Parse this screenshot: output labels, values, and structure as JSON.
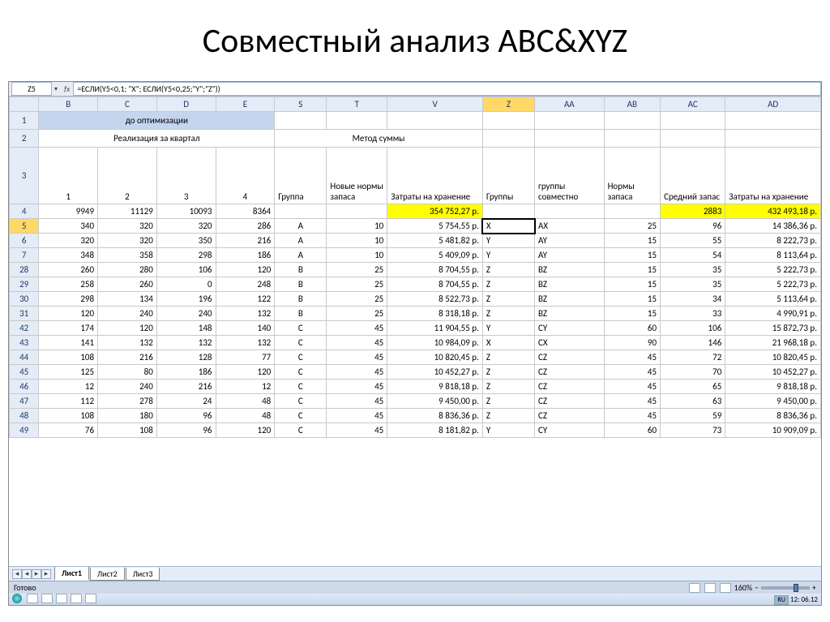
{
  "slide": {
    "title": "Совместный анализ ABC&XYZ"
  },
  "formula_bar": {
    "cell_ref": "Z5",
    "fx": "fx",
    "formula": "=ЕСЛИ(Y5<0,1; \"X\"; ЕСЛИ(Y5<0,25;\"Y\";\"Z\"))"
  },
  "columns": [
    "B",
    "C",
    "D",
    "E",
    "S",
    "T",
    "V",
    "Z",
    "AA",
    "AB",
    "AC",
    "AD"
  ],
  "headers": {
    "r1_merge": "до оптимизации",
    "r2_left": "Реализация за квартал",
    "r2_right": "Метод суммы",
    "q1": "1",
    "q2": "2",
    "q3": "3",
    "q4": "4",
    "group": "Группа",
    "newnorm": "Новые нормы запаса",
    "cost": "Затраты на хранение",
    "groups": "Группы",
    "combined": "группы совместно",
    "norm": "Нормы запаса",
    "avg": "Средний запас",
    "cost2": "Затраты на хранение"
  },
  "rows": [
    {
      "n": "4",
      "c": [
        "9949",
        "11129",
        "10093",
        "8364",
        "",
        "",
        "354 752,27 р.",
        "",
        "",
        "",
        "2883",
        "432 493,18 р."
      ],
      "yellow": [
        6,
        10,
        11
      ]
    },
    {
      "n": "5",
      "c": [
        "340",
        "320",
        "320",
        "286",
        "A",
        "10",
        "5 754,55 р.",
        "X",
        "AX",
        "25",
        "96",
        "14 386,36 р."
      ],
      "sel": 7
    },
    {
      "n": "6",
      "c": [
        "320",
        "320",
        "350",
        "216",
        "A",
        "10",
        "5 481,82 р.",
        "Y",
        "AY",
        "15",
        "55",
        "8 222,73 р."
      ]
    },
    {
      "n": "7",
      "c": [
        "348",
        "358",
        "298",
        "186",
        "A",
        "10",
        "5 409,09 р.",
        "Y",
        "AY",
        "15",
        "54",
        "8 113,64 р."
      ]
    },
    {
      "n": "28",
      "c": [
        "260",
        "280",
        "106",
        "120",
        "B",
        "25",
        "8 704,55 р.",
        "Z",
        "BZ",
        "15",
        "35",
        "5 222,73 р."
      ]
    },
    {
      "n": "29",
      "c": [
        "258",
        "260",
        "0",
        "248",
        "B",
        "25",
        "8 704,55 р.",
        "Z",
        "BZ",
        "15",
        "35",
        "5 222,73 р."
      ]
    },
    {
      "n": "30",
      "c": [
        "298",
        "134",
        "196",
        "122",
        "B",
        "25",
        "8 522,73 р.",
        "Z",
        "BZ",
        "15",
        "34",
        "5 113,64 р."
      ]
    },
    {
      "n": "31",
      "c": [
        "120",
        "240",
        "240",
        "132",
        "B",
        "25",
        "8 318,18 р.",
        "Z",
        "BZ",
        "15",
        "33",
        "4 990,91 р."
      ]
    },
    {
      "n": "42",
      "c": [
        "174",
        "120",
        "148",
        "140",
        "C",
        "45",
        "11 904,55 р.",
        "Y",
        "CY",
        "60",
        "106",
        "15 872,73 р."
      ]
    },
    {
      "n": "43",
      "c": [
        "141",
        "132",
        "132",
        "132",
        "C",
        "45",
        "10 984,09 р.",
        "X",
        "CX",
        "90",
        "146",
        "21 968,18 р."
      ]
    },
    {
      "n": "44",
      "c": [
        "108",
        "216",
        "128",
        "77",
        "C",
        "45",
        "10 820,45 р.",
        "Z",
        "CZ",
        "45",
        "72",
        "10 820,45 р."
      ]
    },
    {
      "n": "45",
      "c": [
        "125",
        "80",
        "186",
        "120",
        "C",
        "45",
        "10 452,27 р.",
        "Z",
        "CZ",
        "45",
        "70",
        "10 452,27 р."
      ]
    },
    {
      "n": "46",
      "c": [
        "12",
        "240",
        "216",
        "12",
        "C",
        "45",
        "9 818,18 р.",
        "Z",
        "CZ",
        "45",
        "65",
        "9 818,18 р."
      ]
    },
    {
      "n": "47",
      "c": [
        "112",
        "278",
        "24",
        "48",
        "C",
        "45",
        "9 450,00 р.",
        "Z",
        "CZ",
        "45",
        "63",
        "9 450,00 р."
      ]
    },
    {
      "n": "48",
      "c": [
        "108",
        "180",
        "96",
        "48",
        "C",
        "45",
        "8 836,36 р.",
        "Z",
        "CZ",
        "45",
        "59",
        "8 836,36 р."
      ]
    },
    {
      "n": "49",
      "c": [
        "76",
        "108",
        "96",
        "120",
        "C",
        "45",
        "8 181,82 р.",
        "Y",
        "CY",
        "60",
        "73",
        "10 909,09 р."
      ]
    }
  ],
  "tabs": {
    "t1": "Лист1",
    "t2": "Лист2",
    "t3": "Лист3"
  },
  "status": {
    "ready": "Готово",
    "zoom": "160%"
  },
  "taskbar": {
    "lang": "RU",
    "time": "12:",
    "date": "06.12"
  }
}
